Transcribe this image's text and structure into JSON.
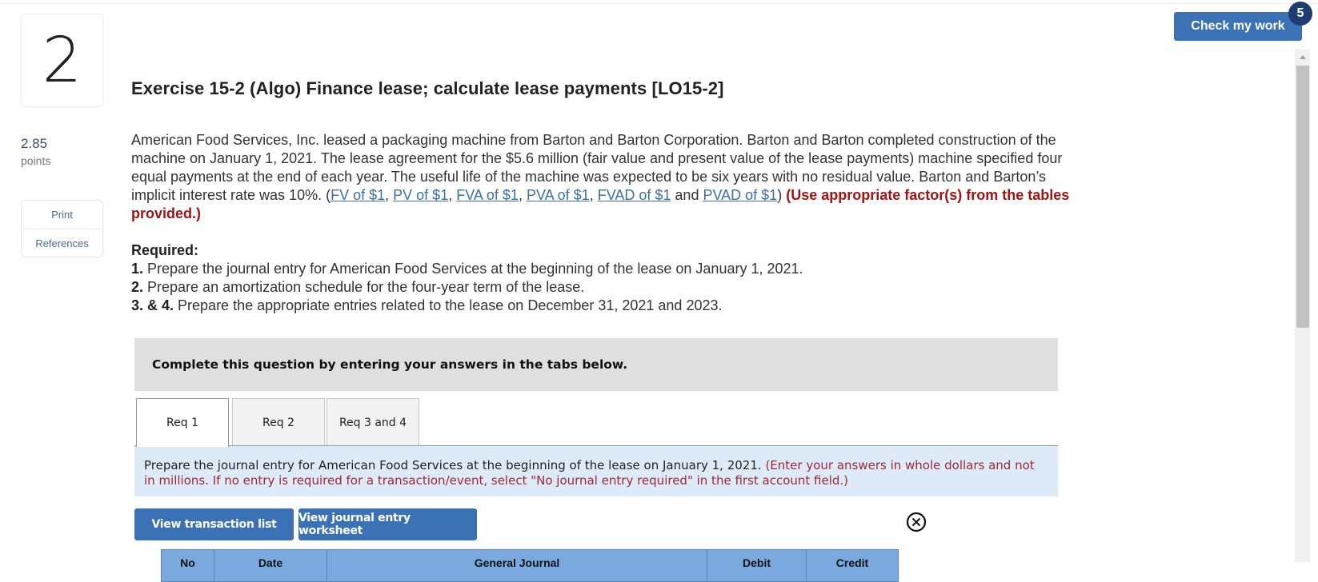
{
  "question": {
    "number": "2",
    "points_value": "2.85",
    "points_label": "points"
  },
  "side_links": {
    "print": "Print",
    "references": "References"
  },
  "header": {
    "check_my_work": "Check my work",
    "badge_count": "5"
  },
  "title": "Exercise 15-2 (Algo) Finance lease; calculate lease payments [LO15-2]",
  "problem": {
    "text": "American Food Services, Inc. leased a packaging machine from Barton and Barton Corporation. Barton and Barton completed construction of the machine on January 1, 2021. The lease agreement for the $5.6 million (fair value and present value of the lease payments) machine specified four equal payments at the end of each year. The useful life of the machine was expected to be six years with no residual value. Barton and Barton’s implicit interest rate was 10%. (",
    "links": [
      "FV of $1",
      "PV of $1",
      "FVA of $1",
      "PVA of $1",
      "FVAD of $1",
      "PVAD of $1"
    ],
    "and_word": " and ",
    "sep": ", ",
    "close_paren": ")",
    "note": "(Use appropriate factor(s) from the tables provided.)"
  },
  "required": {
    "heading": "Required:",
    "items": [
      {
        "num": "1.",
        "text": " Prepare the journal entry for American Food Services at the beginning of the lease on January 1, 2021."
      },
      {
        "num": "2.",
        "text": " Prepare an amortization schedule for the four-year term of the lease."
      },
      {
        "num": "3. & 4.",
        "text": " Prepare the appropriate entries related to the lease on December 31, 2021 and 2023."
      }
    ]
  },
  "complete_box": "Complete this question by entering your answers in the tabs below.",
  "tabs": [
    {
      "label": "Req 1",
      "active": true
    },
    {
      "label": "Req 2",
      "active": false
    },
    {
      "label": "Req 3 and 4",
      "active": false
    }
  ],
  "instruction": {
    "text": "Prepare the journal entry for American Food Services at the beginning of the lease on January 1, 2021. ",
    "note": "(Enter your answers in whole dollars and not in millions. If no entry is required for a transaction/event, select \"No journal entry required\" in the first account field.)"
  },
  "buttons": {
    "view_transaction_list": "View transaction list",
    "view_journal_entry_worksheet": "View journal entry worksheet"
  },
  "journal_table": {
    "columns": [
      "No",
      "Date",
      "General Journal",
      "Debit",
      "Credit"
    ]
  },
  "colors": {
    "primary_button": "#3a72b5",
    "badge": "#1c3d6e",
    "link": "#3d6fa5",
    "note_red": "#a11414",
    "table_header": "#7aa9e0",
    "instruction_bg": "#dcebf7"
  }
}
